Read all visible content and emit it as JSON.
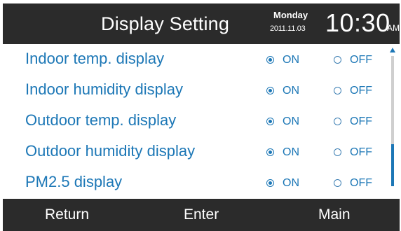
{
  "header": {
    "title": "Display Setting",
    "day": "Monday",
    "date": "2011.11.03",
    "time": "10:30",
    "ampm": "AM"
  },
  "settings": [
    {
      "label": "Indoor temp. display",
      "on_label": "ON",
      "off_label": "OFF",
      "value": "on"
    },
    {
      "label": "Indoor humidity display",
      "on_label": "ON",
      "off_label": "OFF",
      "value": "on"
    },
    {
      "label": "Outdoor temp. display",
      "on_label": "ON",
      "off_label": "OFF",
      "value": "on"
    },
    {
      "label": "Outdoor humidity display",
      "on_label": "ON",
      "off_label": "OFF",
      "value": "on"
    },
    {
      "label": "PM2.5 display",
      "on_label": "ON",
      "off_label": "OFF",
      "value": "on"
    }
  ],
  "scrollbar": {
    "position_fraction": 0.68,
    "visible_fraction": 0.32
  },
  "footer": {
    "return_label": "Return",
    "enter_label": "Enter",
    "main_label": "Main"
  },
  "colors": {
    "accent": "#1c77b6",
    "bar_background": "#2b2b2b",
    "track": "#cfcfcf"
  },
  "icons": {
    "selected_radio": "radio-filled-icon",
    "unselected_radio": "radio-empty-icon",
    "scroll_up": "triangle-up-icon"
  }
}
